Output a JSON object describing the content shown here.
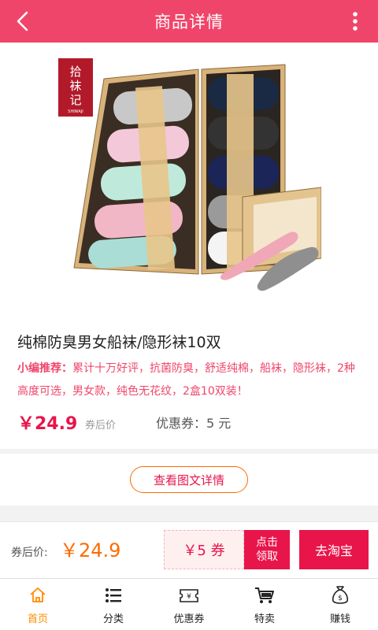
{
  "header": {
    "title": "商品详情",
    "back_icon": "chevron-left-icon",
    "more_icon": "more-vertical-icon"
  },
  "product": {
    "brand_logo": "拾袜记",
    "brand_logo_sub": "SHIWAJI",
    "title": "纯棉防臭男女船袜/隐形袜10双",
    "recommend_label": "小编推荐：",
    "recommend_text": "累计十万好评，抗菌防臭，舒适纯棉，船袜，隐形袜，2种高度可选，男女款，纯色无花纹，2盒10双装！",
    "price": "￥24.9",
    "after_coupon_label": "券后价",
    "coupon_label": "优惠券：",
    "coupon_value": "5 元"
  },
  "detail_button": "查看图文详情",
  "bottom_bar": {
    "label": "券后价:",
    "price": "￥24.9",
    "coupon": "￥5 券",
    "claim_line1": "点击",
    "claim_line2": "领取",
    "taobao": "去淘宝"
  },
  "tabs": [
    {
      "label": "首页",
      "icon": "home-icon",
      "active": true
    },
    {
      "label": "分类",
      "icon": "list-icon",
      "active": false
    },
    {
      "label": "优惠券",
      "icon": "coupon-icon",
      "active": false
    },
    {
      "label": "特卖",
      "icon": "cart-icon",
      "active": false
    },
    {
      "label": "赚钱",
      "icon": "money-bag-icon",
      "active": false
    }
  ],
  "colors": {
    "brand_pink": "#f0456a",
    "price_red": "#e8154a",
    "orange": "#ff6a00",
    "active_tab": "#ff8a00"
  }
}
